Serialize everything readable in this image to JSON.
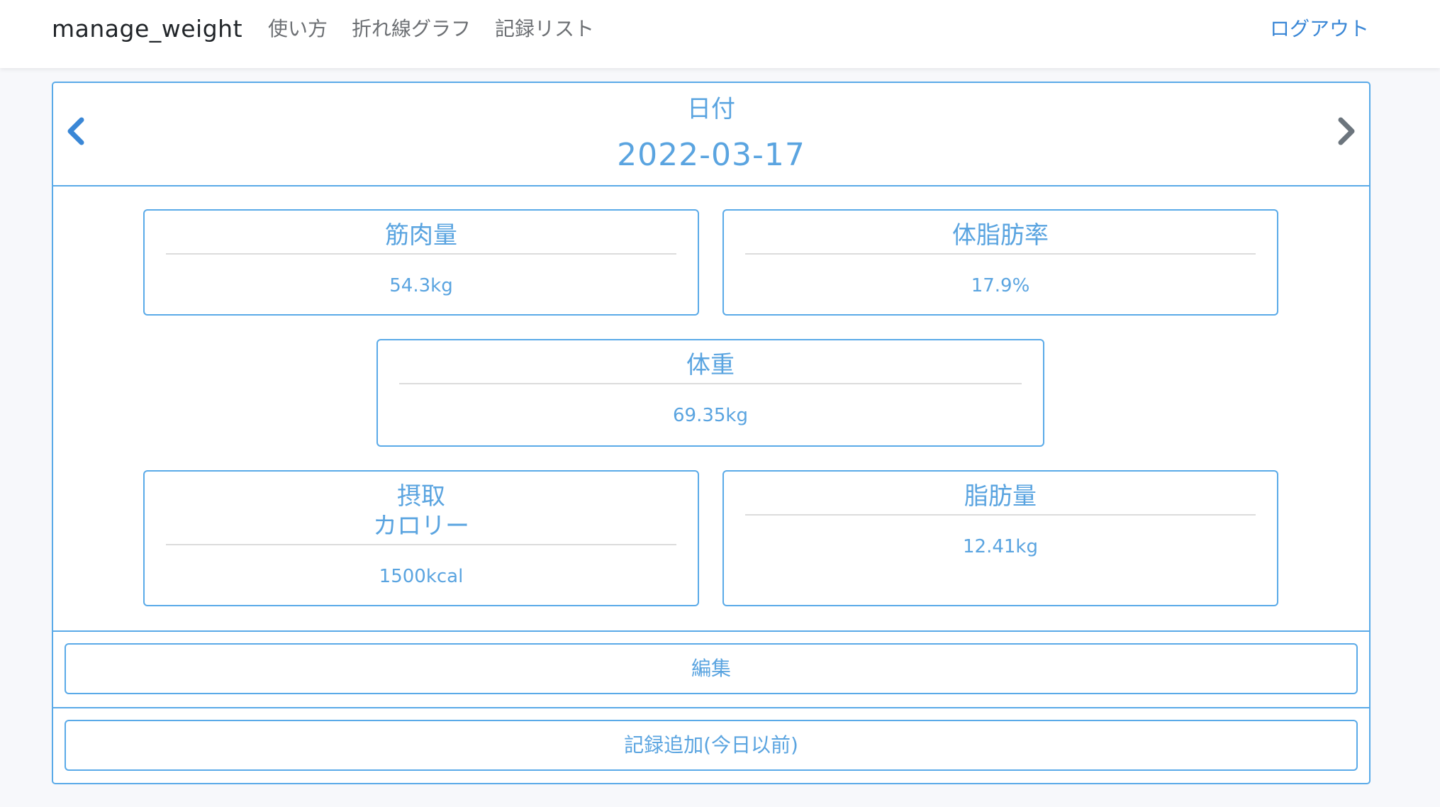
{
  "navbar": {
    "brand": "manage_weight",
    "links": [
      "使い方",
      "折れ線グラフ",
      "記録リスト"
    ],
    "logout": "ログアウト"
  },
  "date_section": {
    "label": "日付",
    "value": "2022-03-17",
    "prev_icon": "chevron-left-icon",
    "next_icon": "chevron-right-icon"
  },
  "stats": {
    "muscle_mass": {
      "title": "筋肉量",
      "value": "54.3kg"
    },
    "body_fat_rate": {
      "title": "体脂肪率",
      "value": "17.9%"
    },
    "weight": {
      "title": "体重",
      "value": "69.35kg"
    },
    "calorie_intake": {
      "title_line1": "摂取",
      "title_line2": "カロリー",
      "value": "1500kcal"
    },
    "fat_mass": {
      "title": "脂肪量",
      "value": "12.41kg"
    }
  },
  "actions": {
    "edit_label": "編集",
    "add_record_label": "記録追加(今日以前)"
  },
  "colors": {
    "accent": "#5aaae8",
    "text_blue": "#5aa4e0",
    "prev_arrow": "#3a87d6",
    "next_arrow": "#6c757d",
    "logout": "#3a87d6"
  }
}
